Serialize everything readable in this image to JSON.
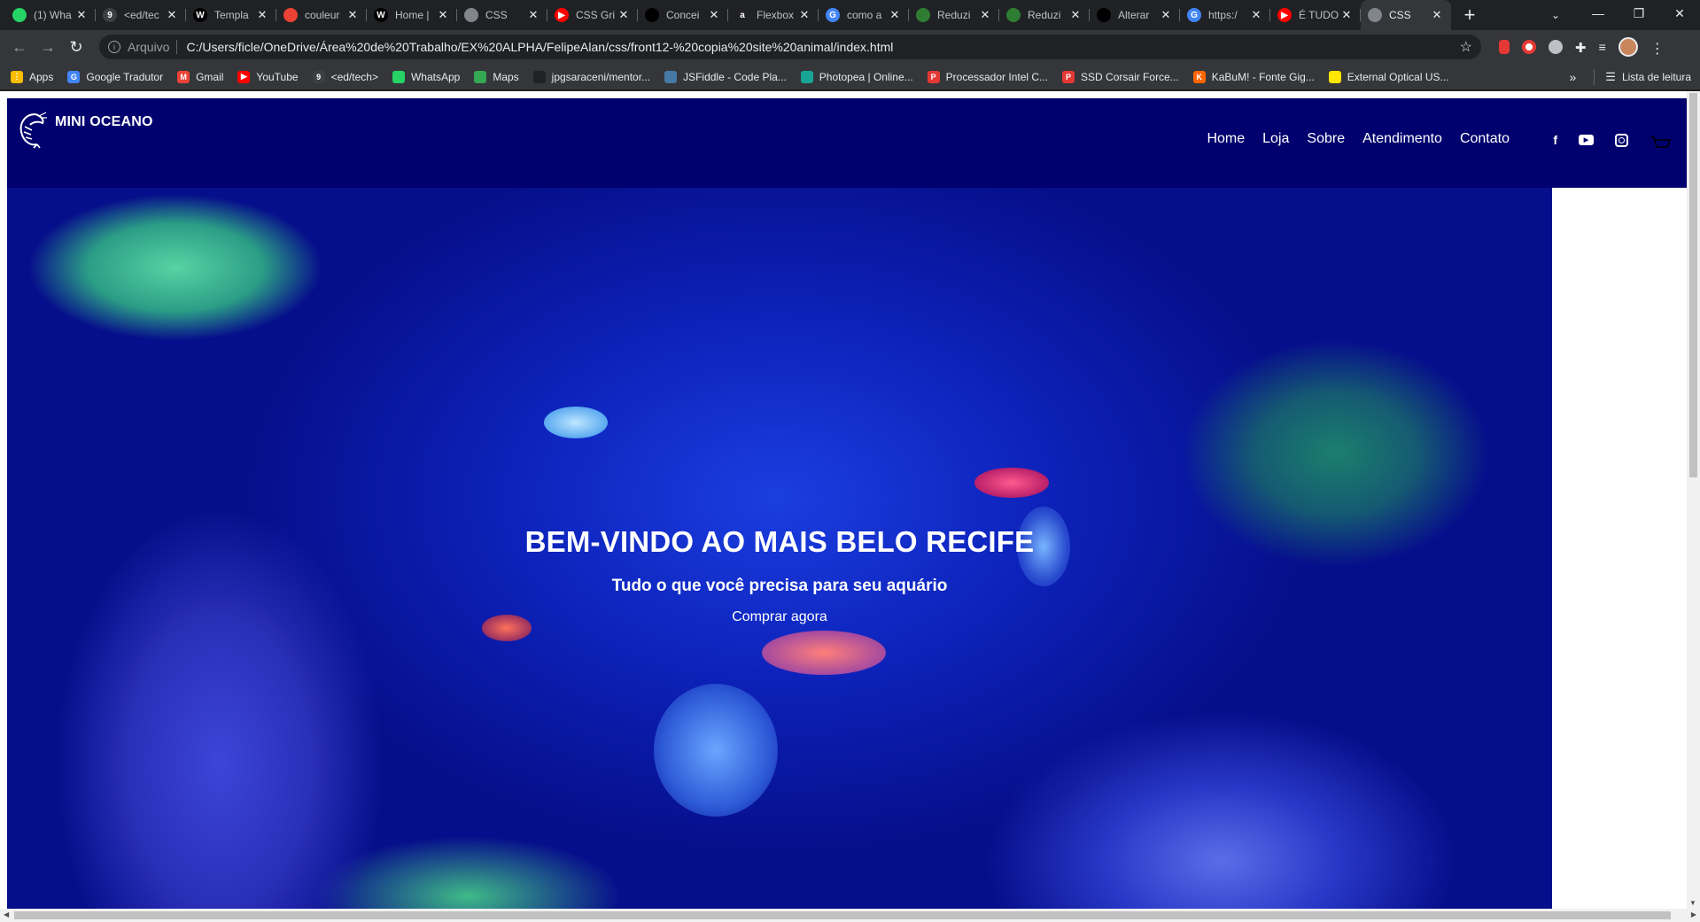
{
  "browser": {
    "tabs": [
      {
        "title": "(1) Wha",
        "icon": "whatsapp-icon",
        "color": "#25d366",
        "glyph": ""
      },
      {
        "title": "<ed/tec",
        "icon": "edtech-icon",
        "color": "#3c4043",
        "glyph": "9"
      },
      {
        "title": "Templa",
        "icon": "wix-icon",
        "color": "#000000",
        "glyph": "W"
      },
      {
        "title": "couleur",
        "icon": "google-colors-icon",
        "color": "#ea4335",
        "glyph": ""
      },
      {
        "title": "Home |",
        "icon": "wix-icon",
        "color": "#000000",
        "glyph": "W"
      },
      {
        "title": "CSS",
        "icon": "globe-icon",
        "color": "#80868b",
        "glyph": ""
      },
      {
        "title": "CSS Gri",
        "icon": "youtube-icon",
        "color": "#ff0000",
        "glyph": "▶"
      },
      {
        "title": "Concei",
        "icon": "site-icon",
        "color": "#000000",
        "glyph": ""
      },
      {
        "title": "Flexbox",
        "icon": "alura-icon",
        "color": "#202124",
        "glyph": "a"
      },
      {
        "title": "como a",
        "icon": "google-icon",
        "color": "#4285f4",
        "glyph": "G"
      },
      {
        "title": "Reduzi",
        "icon": "sheet-icon",
        "color": "#2e7d32",
        "glyph": ""
      },
      {
        "title": "Reduzi",
        "icon": "sheet-icon",
        "color": "#2e7d32",
        "glyph": ""
      },
      {
        "title": "Alterar",
        "icon": "site-icon",
        "color": "#000000",
        "glyph": ""
      },
      {
        "title": "https:/",
        "icon": "google-icon",
        "color": "#4285f4",
        "glyph": "G"
      },
      {
        "title": "É TUDO",
        "icon": "youtube-icon",
        "color": "#ff0000",
        "glyph": "▶"
      },
      {
        "title": "CSS",
        "icon": "globe-icon",
        "color": "#80868b",
        "glyph": "",
        "active": true
      }
    ],
    "address": {
      "scheme": "Arquivo",
      "url": "C:/Users/ficle/OneDrive/Área%20de%20Trabalho/EX%20ALPHA/FelipeAlan/css/front12-%20copia%20site%20animal/index.html"
    },
    "bookmarks": [
      {
        "label": "Apps",
        "icon": "apps-grid-icon",
        "color": "#fbbc04",
        "glyph": "⋮"
      },
      {
        "label": "Google Tradutor",
        "icon": "translate-icon",
        "color": "#4285f4",
        "glyph": "G"
      },
      {
        "label": "Gmail",
        "icon": "gmail-icon",
        "color": "#ea4335",
        "glyph": "M"
      },
      {
        "label": "YouTube",
        "icon": "youtube-icon",
        "color": "#ff0000",
        "glyph": "▶"
      },
      {
        "label": "<ed/tech>",
        "icon": "edtech-icon",
        "color": "#3c4043",
        "glyph": "9"
      },
      {
        "label": "WhatsApp",
        "icon": "whatsapp-icon",
        "color": "#25d366",
        "glyph": ""
      },
      {
        "label": "Maps",
        "icon": "maps-icon",
        "color": "#34a853",
        "glyph": ""
      },
      {
        "label": "jpgsaraceni/mentor...",
        "icon": "github-icon",
        "color": "#202124",
        "glyph": ""
      },
      {
        "label": "JSFiddle - Code Pla...",
        "icon": "jsfiddle-icon",
        "color": "#4679a4",
        "glyph": ""
      },
      {
        "label": "Photopea | Online...",
        "icon": "photopea-icon",
        "color": "#18a497",
        "glyph": ""
      },
      {
        "label": "Processador Intel C...",
        "icon": "pichau-icon",
        "color": "#e53935",
        "glyph": "P"
      },
      {
        "label": "SSD Corsair Force...",
        "icon": "pichau-icon",
        "color": "#e53935",
        "glyph": "P"
      },
      {
        "label": "KaBuM! - Fonte Gig...",
        "icon": "kabum-icon",
        "color": "#ff6500",
        "glyph": "K"
      },
      {
        "label": "External Optical US...",
        "icon": "mercadolivre-icon",
        "color": "#ffe600",
        "glyph": ""
      }
    ],
    "bookmarks_more": "»",
    "reading_list": "Lista de leitura"
  },
  "site": {
    "brand": "MINI OCEANO",
    "nav": [
      "Home",
      "Loja",
      "Sobre",
      "Atendimento",
      "Contato"
    ],
    "social": [
      "facebook-icon",
      "youtube-icon",
      "instagram-icon"
    ],
    "hero": {
      "title": "BEM-VINDO AO MAIS BELO RECIFE",
      "subtitle": "Tudo o que você precisa para seu aquário",
      "cta": "Comprar agora"
    },
    "colors": {
      "header": "#00006e",
      "hero_deep": "#060f8b"
    }
  }
}
